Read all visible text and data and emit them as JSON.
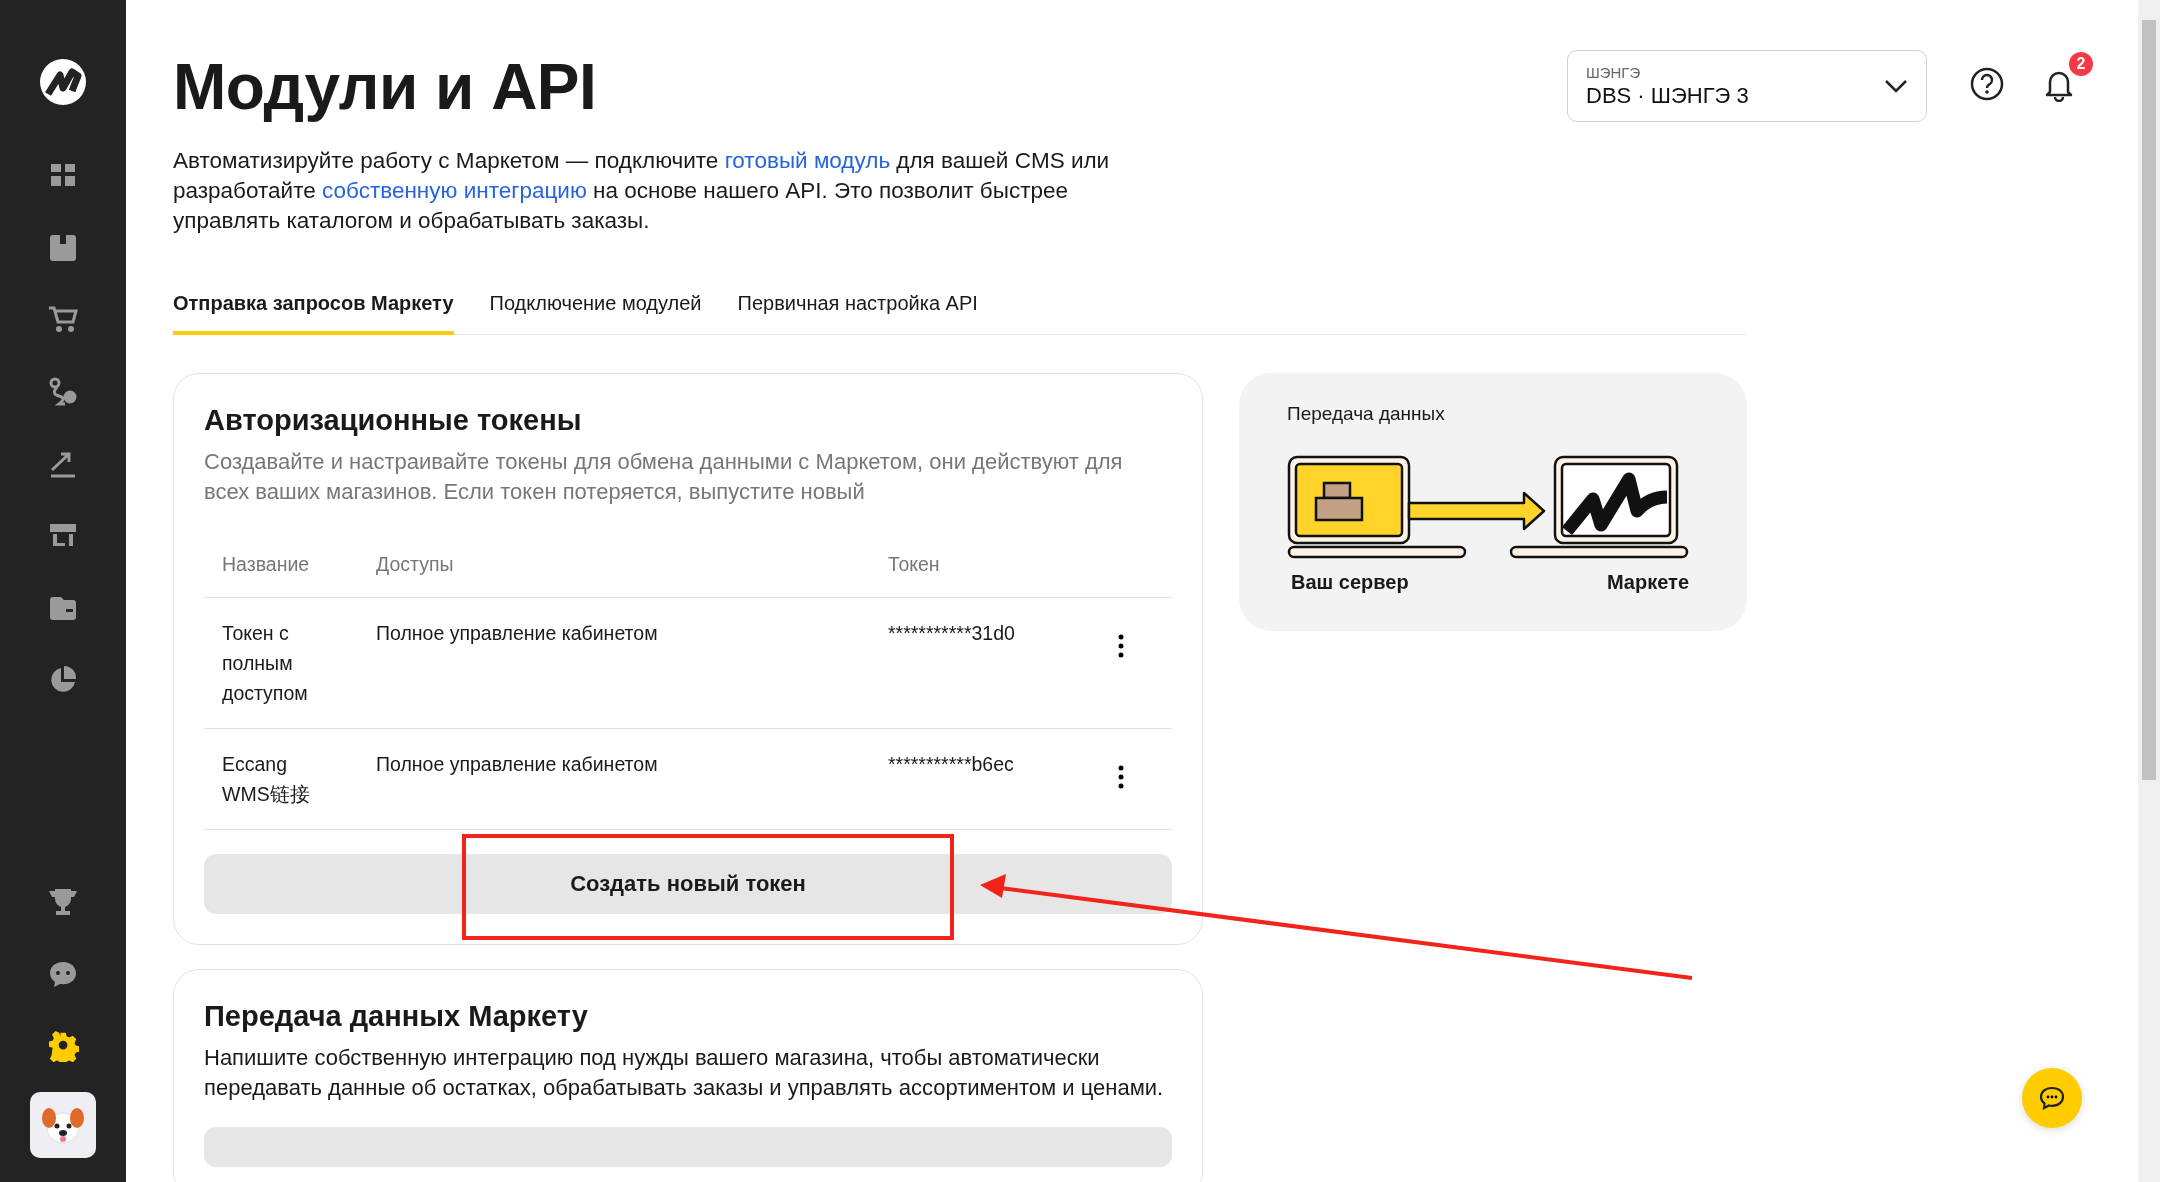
{
  "sidebar": {
    "items": [
      {
        "selected": false
      },
      {
        "selected": false
      },
      {
        "selected": false
      },
      {
        "selected": false
      },
      {
        "selected": false
      },
      {
        "selected": false
      },
      {
        "selected": false
      },
      {
        "selected": false
      },
      {
        "selected": false
      },
      {
        "selected": false
      },
      {
        "selected": true
      }
    ]
  },
  "store_switcher": {
    "label": "ШЭНГЭ",
    "value": "DBS · ШЭНГЭ 3"
  },
  "notifications": {
    "count": "2"
  },
  "page": {
    "title": "Модули и API",
    "description": [
      {
        "kind": "text",
        "text": "Автоматизируйте работу с Маркетом — подключите "
      },
      {
        "kind": "link",
        "text": "готовый модуль"
      },
      {
        "kind": "text",
        "text": " для вашей CMS или разработайте "
      },
      {
        "kind": "link",
        "text": "собственную интеграцию"
      },
      {
        "kind": "text",
        "text": " на основе нашего API. Это позволит быстрее управлять каталогом и обрабатывать заказы."
      }
    ]
  },
  "tabs": [
    {
      "label": "Отправка запросов Маркету",
      "selected": true
    },
    {
      "label": "Подключение модулей",
      "selected": false
    },
    {
      "label": "Первичная настройка API",
      "selected": false
    }
  ],
  "tokens_card": {
    "title": "Авторизационные токены",
    "description": "Создавайте и настраивайте токены для обмена данными с Маркетом, они действуют для всех ваших магазинов. Если токен потеряется, выпустите новый",
    "columns": [
      "Название",
      "Доступы",
      "Токен"
    ],
    "rows": [
      {
        "name": "Токен с полным доступом",
        "access": "Полное управление кабинетом",
        "token": "***********31d0"
      },
      {
        "name": "Eccang WMS链接",
        "access": "Полное управление кабинетом",
        "token": "***********b6ec"
      }
    ],
    "button": "Создать новый токен"
  },
  "illustration": {
    "title": "Передача данных",
    "from": "Ваш сервер",
    "to": "Маркете"
  },
  "integration_card": {
    "title": "Передача данных Маркету",
    "text": "Напишите собственную интеграцию под нужды вашего магазина, чтобы автоматически передавать данные об остатках, обрабатывать заказы и управлять ассортиментом и ценами."
  }
}
